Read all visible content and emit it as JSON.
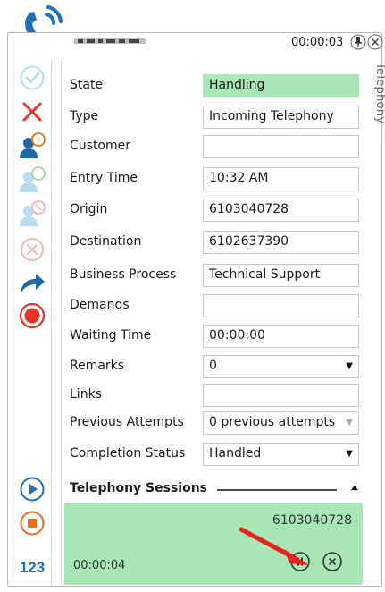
{
  "window": {
    "timer": "00:00:03",
    "side_tab_label": "Telephony"
  },
  "toolbar": {
    "items": [
      {
        "icon": "checkmark-icon",
        "color": "#b9ddee"
      },
      {
        "icon": "cross-icon",
        "color": "#e8332b"
      },
      {
        "icon": "user-phone-icon",
        "color": "#2067a6"
      },
      {
        "icon": "user-chat-icon",
        "color": "#b9ddee"
      },
      {
        "icon": "user-chat-cancel-icon",
        "color": "#b9ddee"
      },
      {
        "icon": "cancel-circle-icon",
        "color": "#f5b9b9"
      },
      {
        "icon": "forward-arrow-icon",
        "color": "#2067a6"
      },
      {
        "icon": "record-icon",
        "color": "#e8332b"
      },
      {
        "icon": "play-icon",
        "color": "#1e6fb8"
      },
      {
        "icon": "stop-icon",
        "color": "#ee6a1e"
      }
    ],
    "keypad_label": "123"
  },
  "form": {
    "rows": [
      {
        "label": "State",
        "value": "Handling"
      },
      {
        "label": "Type",
        "value": "Incoming Telephony"
      },
      {
        "label": "Customer",
        "value": ""
      },
      {
        "label": "Entry Time",
        "value": "10:32 AM"
      },
      {
        "label": "Origin",
        "value": "6103040728"
      },
      {
        "label": "Destination",
        "value": "6102637390"
      },
      {
        "label": "Business Process",
        "value": "Technical Support"
      },
      {
        "label": "Demands",
        "value": ""
      },
      {
        "label": "Waiting Time",
        "value": "00:00:00"
      },
      {
        "label": "Remarks",
        "value": "0"
      },
      {
        "label": "Links",
        "value": ""
      },
      {
        "label": "Previous Attempts",
        "value": "0 previous attempts"
      },
      {
        "label": "Completion Status",
        "value": "Handled"
      }
    ]
  },
  "sessions": {
    "header": "Telephony Sessions",
    "card": {
      "number": "6103040728",
      "duration": "00:00:04"
    }
  },
  "colors": {
    "accent_green": "#a8e6b8",
    "brand_blue": "#1e6fb8",
    "annotation_red": "#e8221d"
  }
}
